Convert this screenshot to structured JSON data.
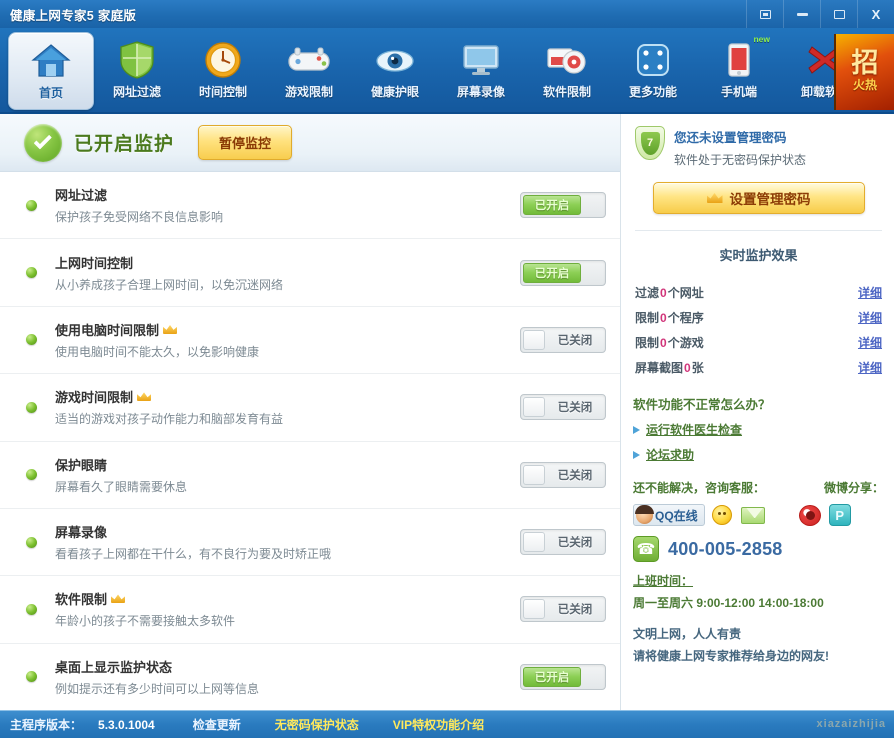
{
  "window": {
    "title": "健康上网专家5 家庭版",
    "controls": [
      {
        "name": "skin-button",
        "label": ""
      },
      {
        "name": "minimize-button",
        "label": ""
      },
      {
        "name": "maximize-button",
        "label": ""
      },
      {
        "name": "close-button",
        "label": "X"
      }
    ]
  },
  "toolbar": {
    "items": [
      {
        "label": "首页",
        "icon": "home-icon",
        "active": true,
        "badge": ""
      },
      {
        "label": "网址过滤",
        "icon": "shield-icon",
        "active": false,
        "badge": ""
      },
      {
        "label": "时间控制",
        "icon": "clock-icon",
        "active": false,
        "badge": ""
      },
      {
        "label": "游戏限制",
        "icon": "gamepad-icon",
        "active": false,
        "badge": ""
      },
      {
        "label": "健康护眼",
        "icon": "eye-icon",
        "active": false,
        "badge": ""
      },
      {
        "label": "屏幕录像",
        "icon": "monitor-icon",
        "active": false,
        "badge": ""
      },
      {
        "label": "软件限制",
        "icon": "disc-icon",
        "active": false,
        "badge": ""
      },
      {
        "label": "更多功能",
        "icon": "dice-icon",
        "active": false,
        "badge": ""
      },
      {
        "label": "手机端",
        "icon": "phone-icon",
        "active": false,
        "badge": "new"
      },
      {
        "label": "卸载软件",
        "icon": "red-x-icon",
        "active": false,
        "badge": ""
      }
    ],
    "promo": {
      "big": "招",
      "small": "火热"
    }
  },
  "status_header": {
    "icon": "green-check-icon",
    "text": "已开启监护",
    "pause_button": "暂停监控"
  },
  "features": [
    {
      "title": "网址过滤",
      "vip": false,
      "desc": "保护孩子免受网络不良信息影响",
      "state": "on",
      "toggle_label": "已开启"
    },
    {
      "title": "上网时间控制",
      "vip": false,
      "desc": "从小养成孩子合理上网时间，以免沉迷网络",
      "state": "on",
      "toggle_label": "已开启"
    },
    {
      "title": "使用电脑时间限制",
      "vip": true,
      "desc": "使用电脑时间不能太久，以免影响健康",
      "state": "off",
      "toggle_label": "已关闭"
    },
    {
      "title": "游戏时间限制",
      "vip": true,
      "desc": "适当的游戏对孩子动作能力和脑部发育有益",
      "state": "off",
      "toggle_label": "已关闭"
    },
    {
      "title": "保护眼睛",
      "vip": false,
      "desc": "屏幕看久了眼睛需要休息",
      "state": "off",
      "toggle_label": "已关闭"
    },
    {
      "title": "屏幕录像",
      "vip": false,
      "desc": "看看孩子上网都在干什么，有不良行为要及时矫正哦",
      "state": "off",
      "toggle_label": "已关闭"
    },
    {
      "title": "软件限制",
      "vip": true,
      "desc": "年龄小的孩子不需要接触太多软件",
      "state": "off",
      "toggle_label": "已关闭"
    },
    {
      "title": "桌面上显示监护状态",
      "vip": false,
      "desc": "例如提示还有多少时间可以上网等信息",
      "state": "on",
      "toggle_label": "已开启"
    }
  ],
  "sidebar": {
    "password": {
      "icon": "green-shield-icon",
      "shield_glyph": "7",
      "title": "您还未设置管理密码",
      "sub": "软件处于无密码保护状态",
      "button": "设置管理密码"
    },
    "realtime_heading": "实时监护效果",
    "stats": [
      {
        "label_before": "过滤",
        "value": "0",
        "label_after": "个网址",
        "link": "详细"
      },
      {
        "label_before": "限制",
        "value": "0",
        "label_after": "个程序",
        "link": "详细"
      },
      {
        "label_before": "限制",
        "value": "0",
        "label_after": "个游戏",
        "link": "详细"
      },
      {
        "label_before": "屏幕截图",
        "value": "0",
        "label_after": "张",
        "link": "详细"
      }
    ],
    "help": {
      "title": "软件功能不正常怎么办？",
      "links": [
        "运行软件医生检查",
        "论坛求助"
      ]
    },
    "service": {
      "left": "还不能解决，咨询客服：",
      "right": "微博分享：",
      "qq_label": "QQ在线",
      "tel": "400-005-2858",
      "hours_title": "上班时间：",
      "hours_value": "周一至周六 9:00-12:00 14:00-18:00"
    },
    "slogan": {
      "line1": "文明上网，人人有责",
      "line2": "请将健康上网专家推荐给身边的网友!"
    }
  },
  "statusbar": {
    "version_label": "主程序版本：",
    "version_value": "5.3.0.1004",
    "check_update": "检查更新",
    "password_state": "无密码保护状态",
    "vip_intro": "VIP特权功能介绍",
    "watermark": "xiazaizhijia"
  }
}
